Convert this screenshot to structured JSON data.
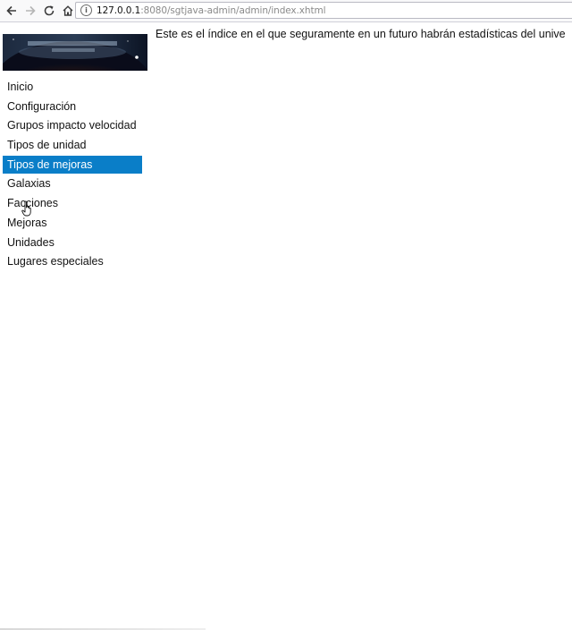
{
  "browser": {
    "url_host": "127.0.0.1",
    "url_rest": ":8080/sgtjava-admin/admin/index.xhtml"
  },
  "sidebar": {
    "items": [
      {
        "label": "Inicio"
      },
      {
        "label": "Configuración"
      },
      {
        "label": "Grupos impacto velocidad"
      },
      {
        "label": "Tipos de unidad"
      },
      {
        "label": "Tipos de mejoras",
        "active": true
      },
      {
        "label": "Galaxias"
      },
      {
        "label": "Facciones"
      },
      {
        "label": "Mejoras"
      },
      {
        "label": "Unidades"
      },
      {
        "label": "Lugares especiales"
      }
    ],
    "active_color": "#0a7ec8"
  },
  "main": {
    "intro_text": "Este es el índice en el que seguramente en un futuro habrán estadísticas del unive"
  },
  "icons": [
    "back-arrow-icon",
    "forward-arrow-icon",
    "reload-icon",
    "home-icon",
    "info-icon",
    "hand-pointer-icon"
  ]
}
